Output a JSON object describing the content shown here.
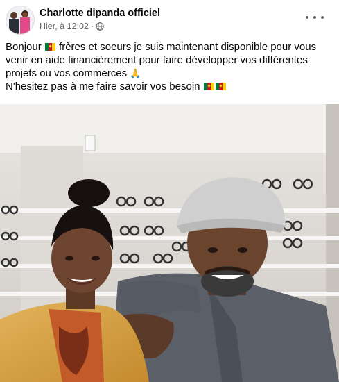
{
  "post": {
    "author": "Charlotte dipanda officiel",
    "timestamp": "Hier, à 12:02",
    "separator": "·",
    "privacy_icon": "globe-icon",
    "more_icon": "more-options-icon",
    "text": {
      "line1_before_flag": "Bonjour ",
      "line1_after_flag": "frères et soeurs je suis maintenant disponible pour vous venir en aide financièrement pour faire développer vos différentes projets ou vos commerces ",
      "pray_emoji": "🙏",
      "line2": "N'hesitez pas à me faire savoir vos besoin ",
      "flag_emoji_name": "cameroon-flag"
    },
    "photo_description_icon": "photo"
  },
  "colors": {
    "author": "#050505",
    "meta": "#65676b",
    "flag_green": "#007a3d",
    "flag_red": "#ce1126",
    "flag_yellow": "#fcd116"
  }
}
